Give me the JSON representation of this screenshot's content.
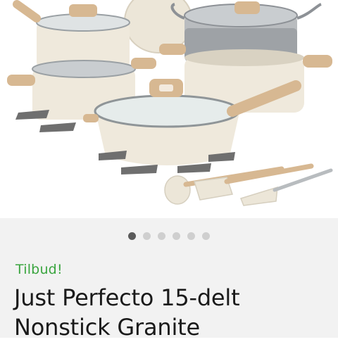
{
  "product": {
    "image_alt": "cream nonstick cookware set with glass lids and wooden handles",
    "badge": "Tilbud!",
    "title": "Just Perfecto 15-delt Nonstick Granite"
  },
  "carousel": {
    "total_slides": 6,
    "active_index": 0
  },
  "colors": {
    "badge": "#3aa53f",
    "body_cream": "#efe9dc",
    "wood_handle": "#d7b892",
    "dot_active": "#5a5a5a",
    "dot_inactive": "#cfcfcf"
  }
}
